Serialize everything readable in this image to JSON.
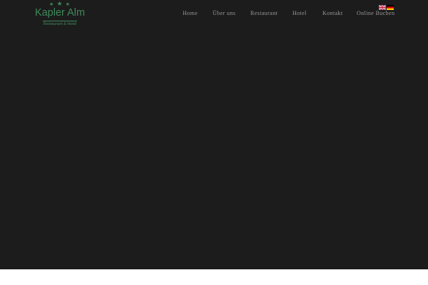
{
  "brand": {
    "name": "Kapler Alm",
    "tagline": "Restaurant & Hotel",
    "stars": "★ ★ ★",
    "color": "#3f8a5a"
  },
  "nav": {
    "items": [
      {
        "label": "Home"
      },
      {
        "label": "Über uns"
      },
      {
        "label": "Restaurant"
      },
      {
        "label": "Hotel"
      },
      {
        "label": "Kontakt"
      },
      {
        "label": "Online Buchen"
      }
    ]
  },
  "languages": [
    {
      "icon": "uk-flag-icon"
    },
    {
      "icon": "germany-flag-icon"
    }
  ],
  "colors": {
    "hero_background": "#1c1c1c",
    "nav_text": "#9a9a9a",
    "page_background": "#ffffff"
  }
}
